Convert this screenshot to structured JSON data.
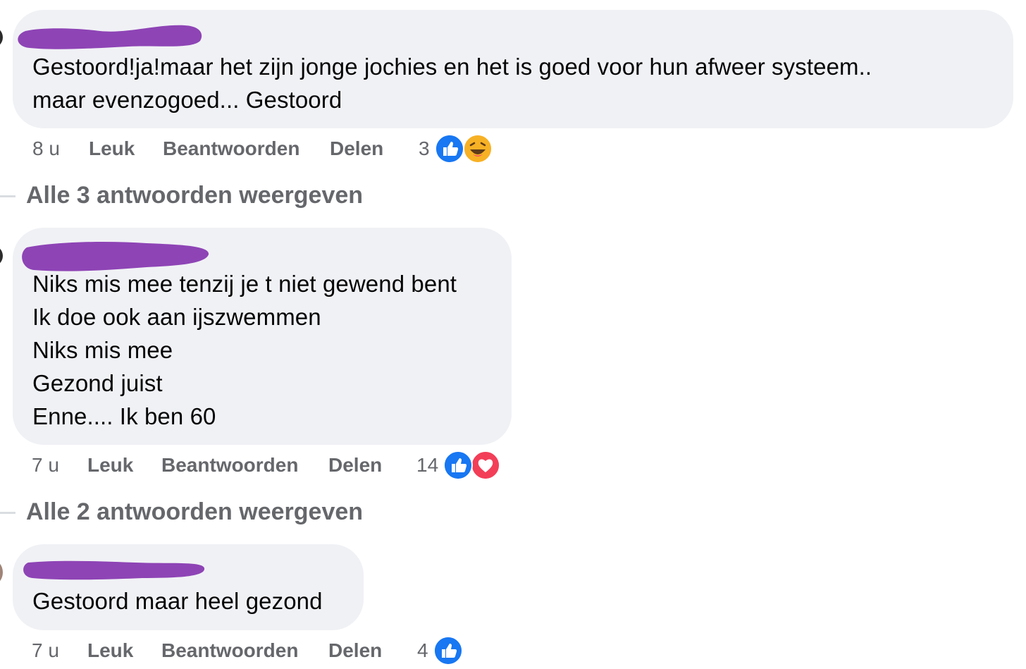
{
  "comments": [
    {
      "lines": [
        "Gestoord!ja!maar het zijn jonge jochies en het is goed voor hun afweer systeem..",
        "maar evenzogoed... Gestoord"
      ],
      "time": "8 u",
      "like_label": "Leuk",
      "reply_label": "Beantwoorden",
      "share_label": "Delen",
      "reaction_count": "3",
      "reactions": [
        "like-icon",
        "haha-icon"
      ],
      "replies_link": "Alle 3 antwoorden weergeven"
    },
    {
      "lines": [
        "Niks mis mee tenzij je t niet gewend bent",
        "Ik doe ook aan ijszwemmen",
        "Niks mis mee",
        "Gezond juist",
        "Enne.... Ik ben 60"
      ],
      "time": "7 u",
      "like_label": "Leuk",
      "reply_label": "Beantwoorden",
      "share_label": "Delen",
      "reaction_count": "14",
      "reactions": [
        "like-icon",
        "love-icon"
      ],
      "replies_link": "Alle 2 antwoorden weergeven"
    },
    {
      "lines": [
        "Gestoord maar heel gezond"
      ],
      "time": "7 u",
      "like_label": "Leuk",
      "reply_label": "Beantwoorden",
      "share_label": "Delen",
      "reaction_count": "4",
      "reactions": [
        "like-icon"
      ]
    }
  ],
  "colors": {
    "bubble": "#f0f1f5",
    "redaction": "#8e44b5",
    "meta_text": "#65676b",
    "like_blue": "#1877f2",
    "love_red": "#f33e58",
    "haha_yellow": "#f7b125"
  }
}
